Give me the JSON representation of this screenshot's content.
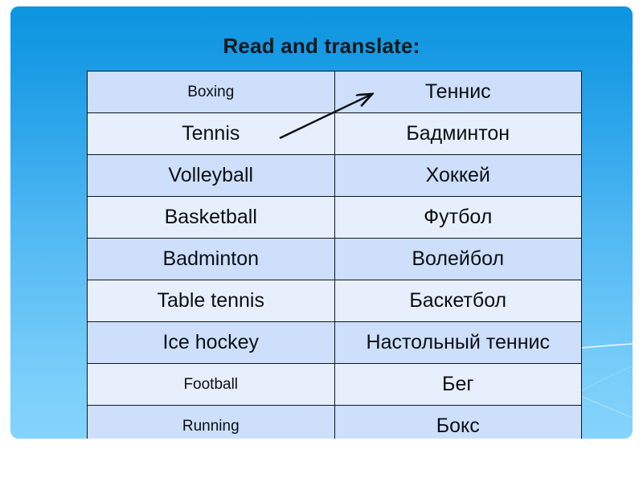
{
  "slide": {
    "title": "Read and translate:",
    "background_top_color": "#0d95e0",
    "background_bottom_color": "#84d4fb"
  },
  "table": {
    "row_fill_odd_color": "#cddffa",
    "row_fill_even_color": "#e7effc",
    "border_color": "#0d1626",
    "rows": [
      {
        "english": "Boxing",
        "russian": "Теннис"
      },
      {
        "english": "Tennis",
        "russian": "Бадминтон"
      },
      {
        "english": "Volleyball",
        "russian": "Хоккей"
      },
      {
        "english": "Basketball",
        "russian": "Футбол"
      },
      {
        "english": "Badminton",
        "russian": "Волейбол"
      },
      {
        "english": "Table tennis",
        "russian": "Баскетбол"
      },
      {
        "english": "Ice hockey",
        "russian": "Настольный теннис"
      },
      {
        "english": "Football",
        "russian": "Бег"
      },
      {
        "english": "Running",
        "russian": "Бокс"
      }
    ]
  },
  "annotation": {
    "arrow_label": "match-arrow",
    "arrow_color": "#0b0f14",
    "from_row": "Tennis",
    "to_row": "Теннис"
  }
}
